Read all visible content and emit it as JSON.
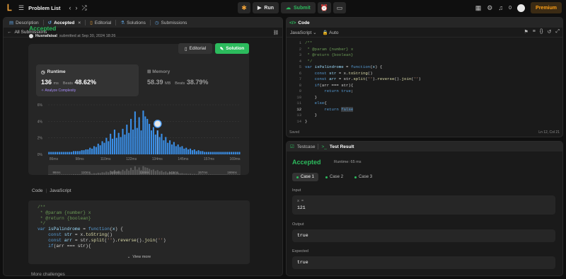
{
  "topbar": {
    "title": "Problem List",
    "run_label": "Run",
    "submit_label": "Submit",
    "notifications": "0",
    "premium_label": "Premium"
  },
  "left_tabs": [
    {
      "label": "Description"
    },
    {
      "label": "Accepted"
    },
    {
      "label": "Editorial"
    },
    {
      "label": "Solutions"
    },
    {
      "label": "Submissions"
    }
  ],
  "subbar": {
    "back_label": "All Submissions"
  },
  "submission": {
    "status": "Accepted",
    "user": "Husnafaisal",
    "submitted_text": "submitted at Sep 30, 2024 18:26",
    "editorial_label": "Editorial",
    "solution_label": "Solution"
  },
  "runtime": {
    "label": "Runtime",
    "value": "136",
    "unit": "ms",
    "beats_label": "Beats",
    "beats": "48.62%",
    "analyze_label": "Analyze Complexity"
  },
  "memory": {
    "label": "Memory",
    "value": "58.39",
    "unit": "MB",
    "beats_label": "Beats",
    "beats": "38.79%"
  },
  "chart_data": {
    "type": "bar",
    "ylim": [
      0,
      6
    ],
    "yticks": [
      "0%",
      "2%",
      "4%",
      "6%"
    ],
    "xticks": [
      "86ms",
      "98ms",
      "110ms",
      "122ms",
      "134ms",
      "145ms",
      "157ms",
      "169ms"
    ],
    "nav_ticks": [
      "86ms",
      "110ms",
      "122ms",
      "134ms",
      "145ms",
      "157ms",
      "169ms"
    ],
    "highlight_value": 136,
    "bins_start_ms": 83,
    "bin_width_ms": 1,
    "values": [
      0.3,
      0.3,
      0.3,
      0.3,
      0.3,
      0.3,
      0.3,
      0.3,
      0.3,
      0.3,
      0.3,
      0.3,
      0.4,
      0.4,
      0.4,
      0.4,
      0.5,
      0.5,
      0.6,
      0.6,
      0.8,
      0.7,
      1.0,
      0.9,
      1.3,
      1.1,
      1.6,
      1.4,
      2.0,
      1.6,
      2.5,
      1.9,
      3.0,
      2.0,
      2.6,
      2.1,
      3.1,
      2.4,
      3.6,
      2.6,
      4.3,
      3.0,
      5.2,
      3.2,
      4.5,
      2.9,
      5.3,
      4.6,
      4.3,
      3.7,
      2.9,
      3.3,
      2.4,
      2.9,
      2.1,
      2.5,
      1.7,
      2.1,
      1.4,
      1.7,
      1.2,
      1.5,
      1.0,
      1.2,
      0.9,
      1.0,
      0.7,
      0.8,
      0.6,
      0.7,
      0.5,
      0.6,
      0.4,
      0.5,
      0.4,
      0.4,
      0.3,
      0.3,
      0.3,
      0.3,
      0.3,
      0.3,
      0.3,
      0.3,
      0.3,
      0.3,
      0.3,
      0.3,
      0.3,
      0.3,
      0.3,
      0.3,
      0.3,
      0.3
    ]
  },
  "code_section": {
    "label": "Code",
    "language": "JavaScript",
    "view_more": "View more"
  },
  "more_challenges": "More challenges",
  "editor": {
    "tab_label": "Code",
    "language": "JavaScript",
    "mode": "Auto",
    "saved": "Saved",
    "position": "Ln 12, Col 21",
    "line_numbers": [
      "1",
      "2",
      "3",
      "4",
      "5",
      "6",
      "7",
      "8",
      "9",
      "10",
      "11",
      "12",
      "13",
      "14"
    ]
  },
  "results": {
    "tab_testcase": "Testcase",
    "tab_result": "Test Result",
    "status": "Accepted",
    "runtime": "Runtime: 65 ms",
    "cases": [
      {
        "label": "Case 1"
      },
      {
        "label": "Case 2"
      },
      {
        "label": "Case 3"
      }
    ],
    "input_label": "Input",
    "input_var": "x =",
    "input_value": "121",
    "output_label": "Output",
    "output_value": "true",
    "expected_label": "Expected",
    "expected_value": "true"
  },
  "colors": {
    "accent_green": "#2cbb5d",
    "bar_blue": "#3a8ee6",
    "premium": "#ffa116"
  }
}
